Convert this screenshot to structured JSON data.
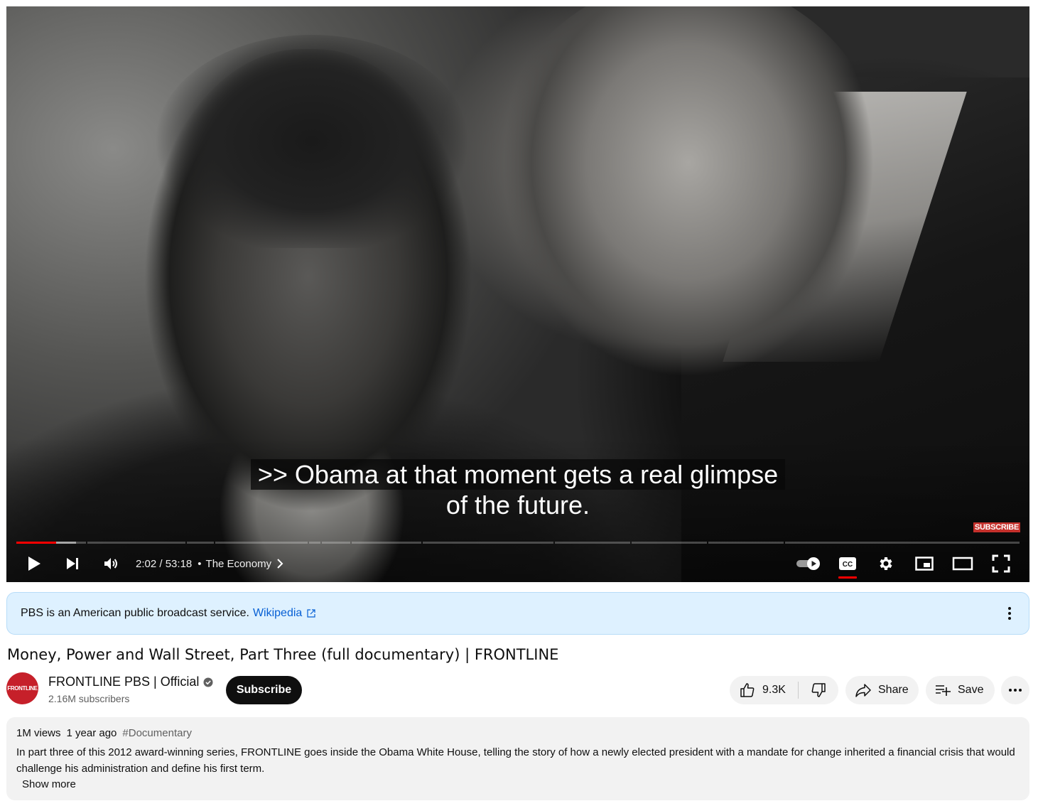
{
  "player": {
    "caption_line1": ">> Obama at that moment gets a real glimpse",
    "caption_line2": "of the future.",
    "watermark": "SUBSCRIBE",
    "time_current": "2:02",
    "time_separator": " / ",
    "time_total": "53:18",
    "chapter_separator": "•",
    "chapter_title": "The Economy",
    "progress_played_fraction": 0.0399,
    "accent_color": "#ff0000"
  },
  "info_panel": {
    "text": "PBS is an American public broadcast service.",
    "link_label": "Wikipedia"
  },
  "video": {
    "title": "Money, Power and Wall Street, Part Three (full documentary) | FRONTLINE"
  },
  "channel": {
    "avatar_text": "FRONTLINE",
    "name": "FRONTLINE PBS | Official",
    "subscribers": "2.16M subscribers",
    "subscribe_label": "Subscribe"
  },
  "actions": {
    "like_count": "9.3K",
    "share_label": "Share",
    "save_label": "Save"
  },
  "description": {
    "views": "1M views",
    "age": "1 year ago",
    "hashtag": "#Documentary",
    "text": "In part three of this 2012 award-winning series, FRONTLINE goes inside the Obama White House, telling the story of how a newly elected president with a mandate for change inherited a financial crisis that would challenge his administration and define his first term.",
    "show_more": "Show more"
  },
  "icons": {
    "play": "play-icon",
    "next": "next-icon",
    "volume": "volume-icon",
    "chevron": "chevron-right-icon",
    "autoplay": "autoplay-toggle-icon",
    "captions": "closed-captions-icon",
    "settings": "gear-icon",
    "miniplayer": "miniplayer-icon",
    "theater": "theater-mode-icon",
    "fullscreen": "fullscreen-icon",
    "external": "external-link-icon",
    "kebab": "more-vertical-icon",
    "verified": "verified-badge-icon",
    "like": "thumbs-up-icon",
    "dislike": "thumbs-down-icon",
    "share": "share-arrow-icon",
    "save": "playlist-add-icon",
    "more": "more-horizontal-icon"
  }
}
